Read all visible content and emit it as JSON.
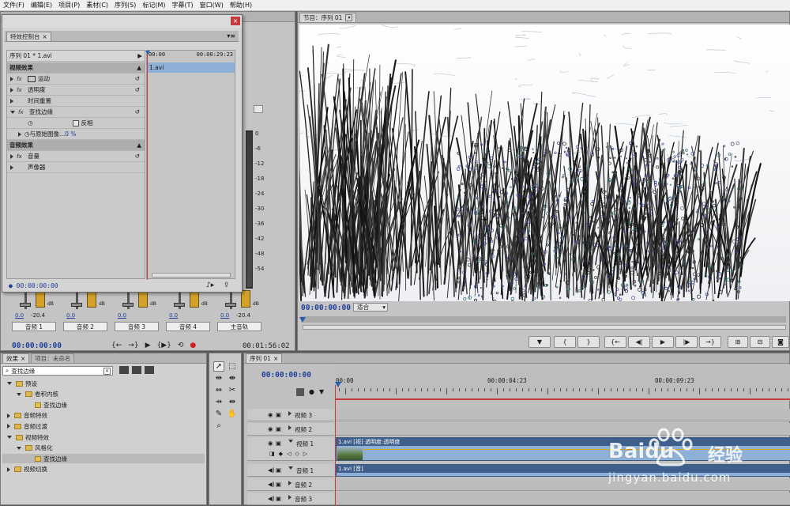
{
  "menu": [
    "文件(F)",
    "编辑(E)",
    "项目(P)",
    "素材(C)",
    "序列(S)",
    "标记(M)",
    "字幕(T)",
    "窗口(W)",
    "帮助(H)"
  ],
  "effect_controls": {
    "tab": "特效控制台",
    "clip_path": "序列 01 * 1.avi",
    "time_start": "00:00",
    "time_end": "00:00:29:23",
    "clip_name": "1.avi",
    "video_effects_label": "视频效果",
    "effects": [
      "运动",
      "透明度",
      "时间重置",
      "查找边缘"
    ],
    "invert_label": "反相",
    "blend_label": "与原始图像...",
    "blend_value": "0 %",
    "audio_effects_label": "音频效果",
    "audio_items": [
      "音量",
      "声像器"
    ],
    "current_time": "00:00:00:00"
  },
  "audio_mixer": {
    "db_scale": [
      "0",
      "-6",
      "-12",
      "-18",
      "-24",
      "-30",
      "-36",
      "-42",
      "-48",
      "-54"
    ],
    "channels": [
      {
        "name": "音频 1",
        "left": "0.0",
        "right": "-20.4"
      },
      {
        "name": "音频 2",
        "left": "0.0",
        "right": ""
      },
      {
        "name": "音频 3",
        "left": "0.0",
        "right": ""
      },
      {
        "name": "音频 4",
        "left": "0.0",
        "right": ""
      },
      {
        "name": "主音轨",
        "left": "0.0",
        "right": "-20.4"
      }
    ],
    "db_unit": "dB",
    "time_left": "00:00:00:00",
    "time_right": "00:01:56:02"
  },
  "program_monitor": {
    "tab": "节目：序列 01",
    "time": "00:00:00:00",
    "fit": "适合"
  },
  "effects_panel": {
    "tabs": [
      "效果",
      "项目：未命名"
    ],
    "search_value": "查找边缘",
    "tree": [
      {
        "label": "预设",
        "level": 0,
        "open": true
      },
      {
        "label": "卷积内核",
        "level": 1,
        "open": true
      },
      {
        "label": "查找边缘",
        "level": 2,
        "item": true
      },
      {
        "label": "音频特效",
        "level": 0
      },
      {
        "label": "音频过渡",
        "level": 0
      },
      {
        "label": "视频特效",
        "level": 0,
        "open": true
      },
      {
        "label": "风格化",
        "level": 1,
        "open": true
      },
      {
        "label": "查找边缘",
        "level": 2,
        "item": true,
        "selected": true
      },
      {
        "label": "视频切换",
        "level": 0
      }
    ]
  },
  "timeline": {
    "tab": "序列 01",
    "time": "00:00:00:00",
    "ruler": [
      "00:00",
      "00:00:04:23",
      "00:00:09:23"
    ],
    "tracks": [
      {
        "name": "视频 3",
        "type": "video"
      },
      {
        "name": "视频 2",
        "type": "video"
      },
      {
        "name": "视频 1",
        "type": "video",
        "clip": "1.avi [视] 透明度:透明度"
      },
      {
        "name": "音频 1",
        "type": "audio",
        "clip": "1.avi [音]"
      },
      {
        "name": "音频 2",
        "type": "audio"
      },
      {
        "name": "音频 3",
        "type": "audio"
      }
    ]
  },
  "watermark": {
    "brand": "Baidu",
    "brand_cn": "经验",
    "url": "jingyan.baidu.com"
  },
  "colors": {
    "accent": "#1f3f9a",
    "playhead": "#d23b3b",
    "clip": "#8fb0d6"
  }
}
